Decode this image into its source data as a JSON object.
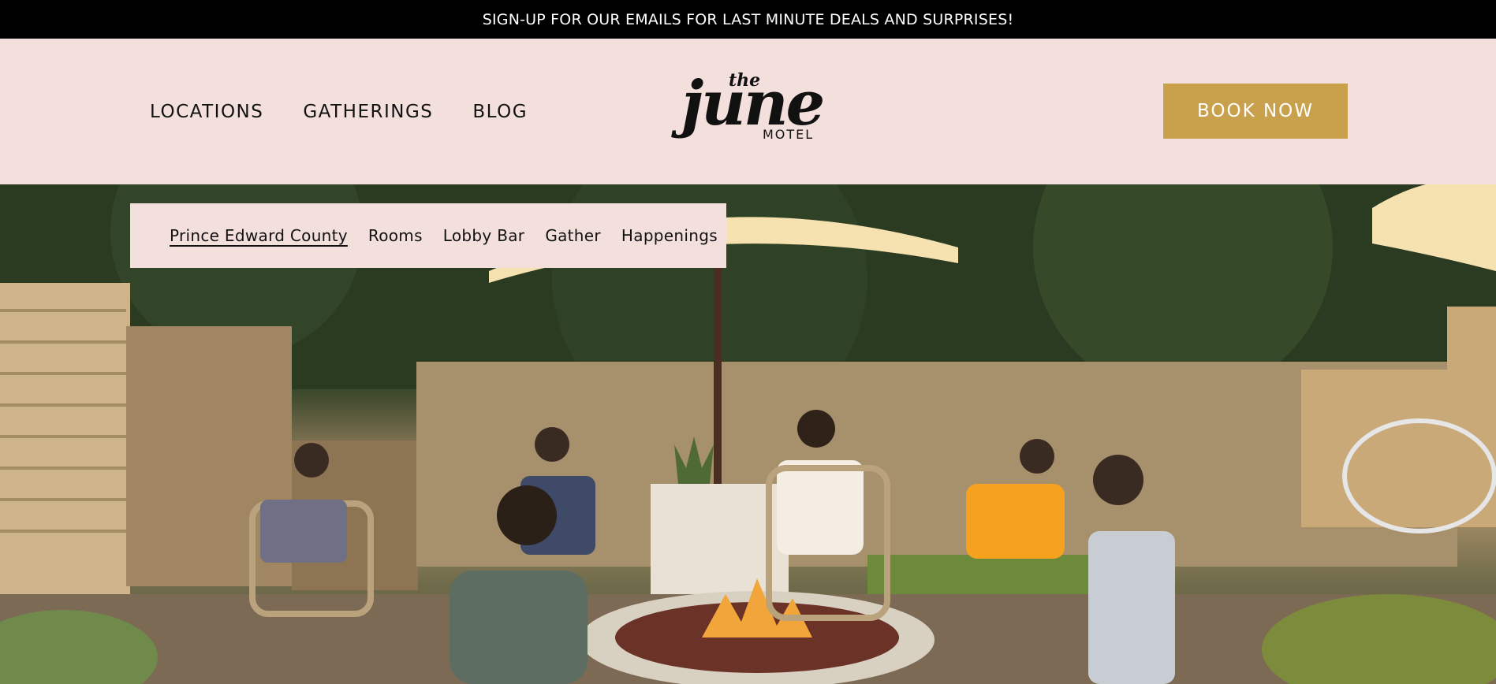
{
  "announcement": "SIGN-UP FOR OUR EMAILS FOR LAST MINUTE DEALS AND SURPRISES!",
  "nav": {
    "items": [
      {
        "label": "LOCATIONS"
      },
      {
        "label": "GATHERINGS"
      },
      {
        "label": "BLOG"
      }
    ]
  },
  "logo": {
    "the": "the",
    "june": "june",
    "motel": "MOTEL"
  },
  "book_button": "BOOK NOW",
  "subnav": {
    "items": [
      {
        "label": "Prince Edward County",
        "active": true
      },
      {
        "label": "Rooms"
      },
      {
        "label": "Lobby Bar"
      },
      {
        "label": "Gather"
      },
      {
        "label": "Happenings"
      }
    ]
  },
  "hero": {
    "image": "people-seated-around-fire-pit-photo"
  },
  "colors": {
    "accent": "#c9a14c",
    "header_bg": "#f3dfdb",
    "announce_bg": "#000000"
  }
}
